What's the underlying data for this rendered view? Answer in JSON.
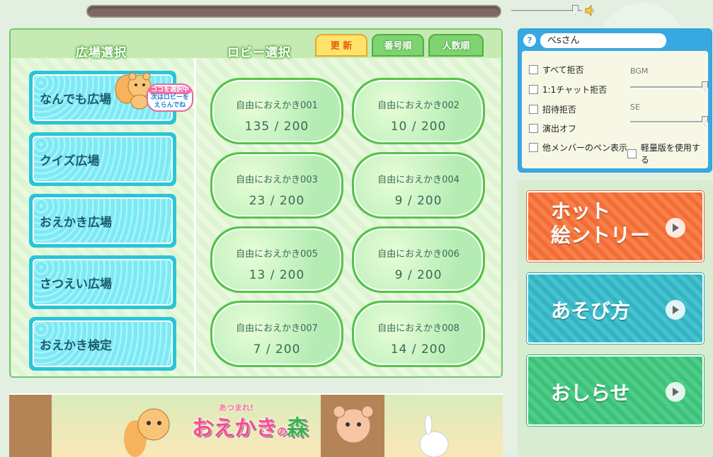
{
  "audio": {
    "volume_level": 0.88
  },
  "plaza_panel": {
    "title": "広場選択",
    "items": [
      {
        "label": "なんでも広場"
      },
      {
        "label": "クイズ広場"
      },
      {
        "label": "おえかき広場"
      },
      {
        "label": "さつえい広場"
      },
      {
        "label": "おえかき検定"
      }
    ],
    "hint": {
      "line1": "ココを選択中",
      "line2": "次はロビーを",
      "line3": "えらんでね"
    }
  },
  "lobby_panel": {
    "title": "ロビー選択",
    "tabs": [
      {
        "label": "更 新",
        "active": true
      },
      {
        "label": "番号順",
        "active": false
      },
      {
        "label": "人数順",
        "active": false
      }
    ],
    "lobbies": [
      {
        "name": "自由におえかき001",
        "count": "135 / 200"
      },
      {
        "name": "自由におえかき002",
        "count": "10 / 200"
      },
      {
        "name": "自由におえかき003",
        "count": "23 / 200"
      },
      {
        "name": "自由におえかき004",
        "count": "9 / 200"
      },
      {
        "name": "自由におえかき005",
        "count": "13 / 200"
      },
      {
        "name": "自由におえかき006",
        "count": "9 / 200"
      },
      {
        "name": "自由におえかき007",
        "count": "7 / 200"
      },
      {
        "name": "自由におえかき008",
        "count": "14 / 200"
      }
    ]
  },
  "banner": {
    "subtitle": "あつまれ!",
    "title_main": "おえかき",
    "title_no": "の",
    "title_forest": "森"
  },
  "settings": {
    "user_name": "べsさん",
    "options": [
      {
        "label": "すべて拒否",
        "checked": false
      },
      {
        "label": "1:1チャット拒否",
        "checked": false
      },
      {
        "label": "招待拒否",
        "checked": false
      },
      {
        "label": "演出オフ",
        "checked": false
      },
      {
        "label": "他メンバーのペン表示",
        "checked": false
      },
      {
        "label": "軽量版を使用する",
        "checked": false
      }
    ],
    "bgm_label": "BGM",
    "se_label": "SE",
    "bgm_level": 1.0,
    "se_level": 1.0
  },
  "side_buttons": {
    "hot_entry_line1": "ホット",
    "hot_entry_line2": "絵ントリー",
    "how_to_play": "あそび方",
    "news": "おしらせ"
  },
  "colors": {
    "accent_green": "#55c449",
    "plaza_cyan": "#29c5d8",
    "hot_orange": "#f26d36",
    "howto_teal": "#35b3c2",
    "news_green": "#3fc07a",
    "settings_blue": "#38a8e0"
  }
}
